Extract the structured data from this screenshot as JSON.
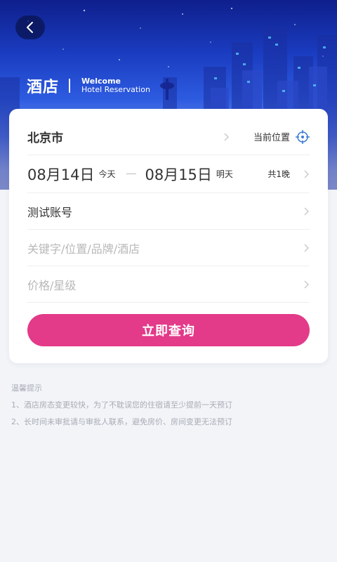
{
  "header": {
    "title": "酒店",
    "welcome": "Welcome",
    "subtitle": "Hotel Reservation"
  },
  "search": {
    "city": "北京市",
    "location_label": "当前位置",
    "checkin_date": "08月14日",
    "checkin_day": "今天",
    "checkout_date": "08月15日",
    "checkout_day": "明天",
    "nights": "共1晚",
    "account": "测试账号",
    "keyword_placeholder": "关键字/位置/品牌/酒店",
    "price_placeholder": "价格/星级",
    "submit_label": "立即查询"
  },
  "tips": {
    "title": "温馨提示",
    "items": [
      "1、酒店房态变更较快，为了不耽误您的住宿请至少提前一天预订",
      "2、长时间未审批请与审批人联系，避免房价、房间变更无法预订"
    ]
  },
  "colors": {
    "accent": "#e33a89",
    "hero_top": "#0f1f8c",
    "hero_mid": "#2d5be0",
    "background": "#f2f4f8"
  }
}
